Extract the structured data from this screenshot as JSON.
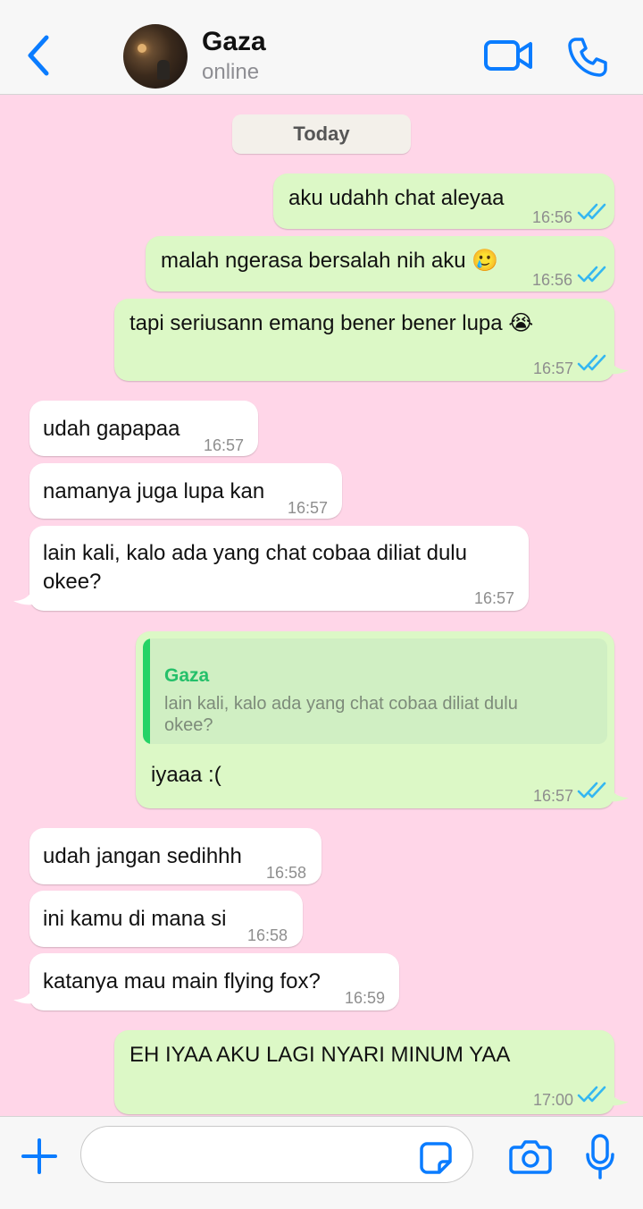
{
  "header": {
    "contact_name": "Gaza",
    "status": "online"
  },
  "date_divider": "Today",
  "colors": {
    "accent": "#0a7cff",
    "outgoing_bubble": "#dcf8c6",
    "incoming_bubble": "#ffffff",
    "chat_background": "#ffd6e8",
    "read_tick": "#34b7f1",
    "quote_name": "#25c06a"
  },
  "icons": {
    "back": "chevron-left-icon",
    "video": "video-camera-icon",
    "call": "phone-icon",
    "plus": "plus-icon",
    "sticker": "sticker-icon",
    "camera": "camera-icon",
    "mic": "microphone-icon",
    "read": "double-check-icon"
  },
  "messages": [
    {
      "direction": "out",
      "text": "aku udahh chat aleyaa",
      "time": "16:56",
      "read": true
    },
    {
      "direction": "out",
      "text": "malah ngerasa bersalah nih aku 🥲",
      "time": "16:56",
      "read": true
    },
    {
      "direction": "out",
      "text": "tapi seriusann emang bener bener lupa 😭",
      "time": "16:57",
      "read": true
    },
    {
      "direction": "in",
      "text": "udah gapapaa",
      "time": "16:57"
    },
    {
      "direction": "in",
      "text": "namanya juga lupa kan",
      "time": "16:57"
    },
    {
      "direction": "in",
      "text_line1": "lain kali, kalo ada yang chat cobaa diliat dulu",
      "text_line2": "okee?",
      "time": "16:57"
    },
    {
      "direction": "out",
      "quote": {
        "author": "Gaza",
        "line1": "lain kali, kalo ada yang chat cobaa diliat dulu",
        "line2": "okee?"
      },
      "text": "iyaaa :(",
      "time": "16:57",
      "read": true
    },
    {
      "direction": "in",
      "text": "udah jangan sedihhh",
      "time": "16:58"
    },
    {
      "direction": "in",
      "text": "ini kamu di mana si",
      "time": "16:58"
    },
    {
      "direction": "in",
      "text": "katanya mau main flying fox?",
      "time": "16:59"
    },
    {
      "direction": "out",
      "text": "EH IYAA AKU LAGI NYARI MINUM YAA",
      "time": "17:00",
      "read": true
    }
  ],
  "composer": {
    "placeholder": ""
  }
}
